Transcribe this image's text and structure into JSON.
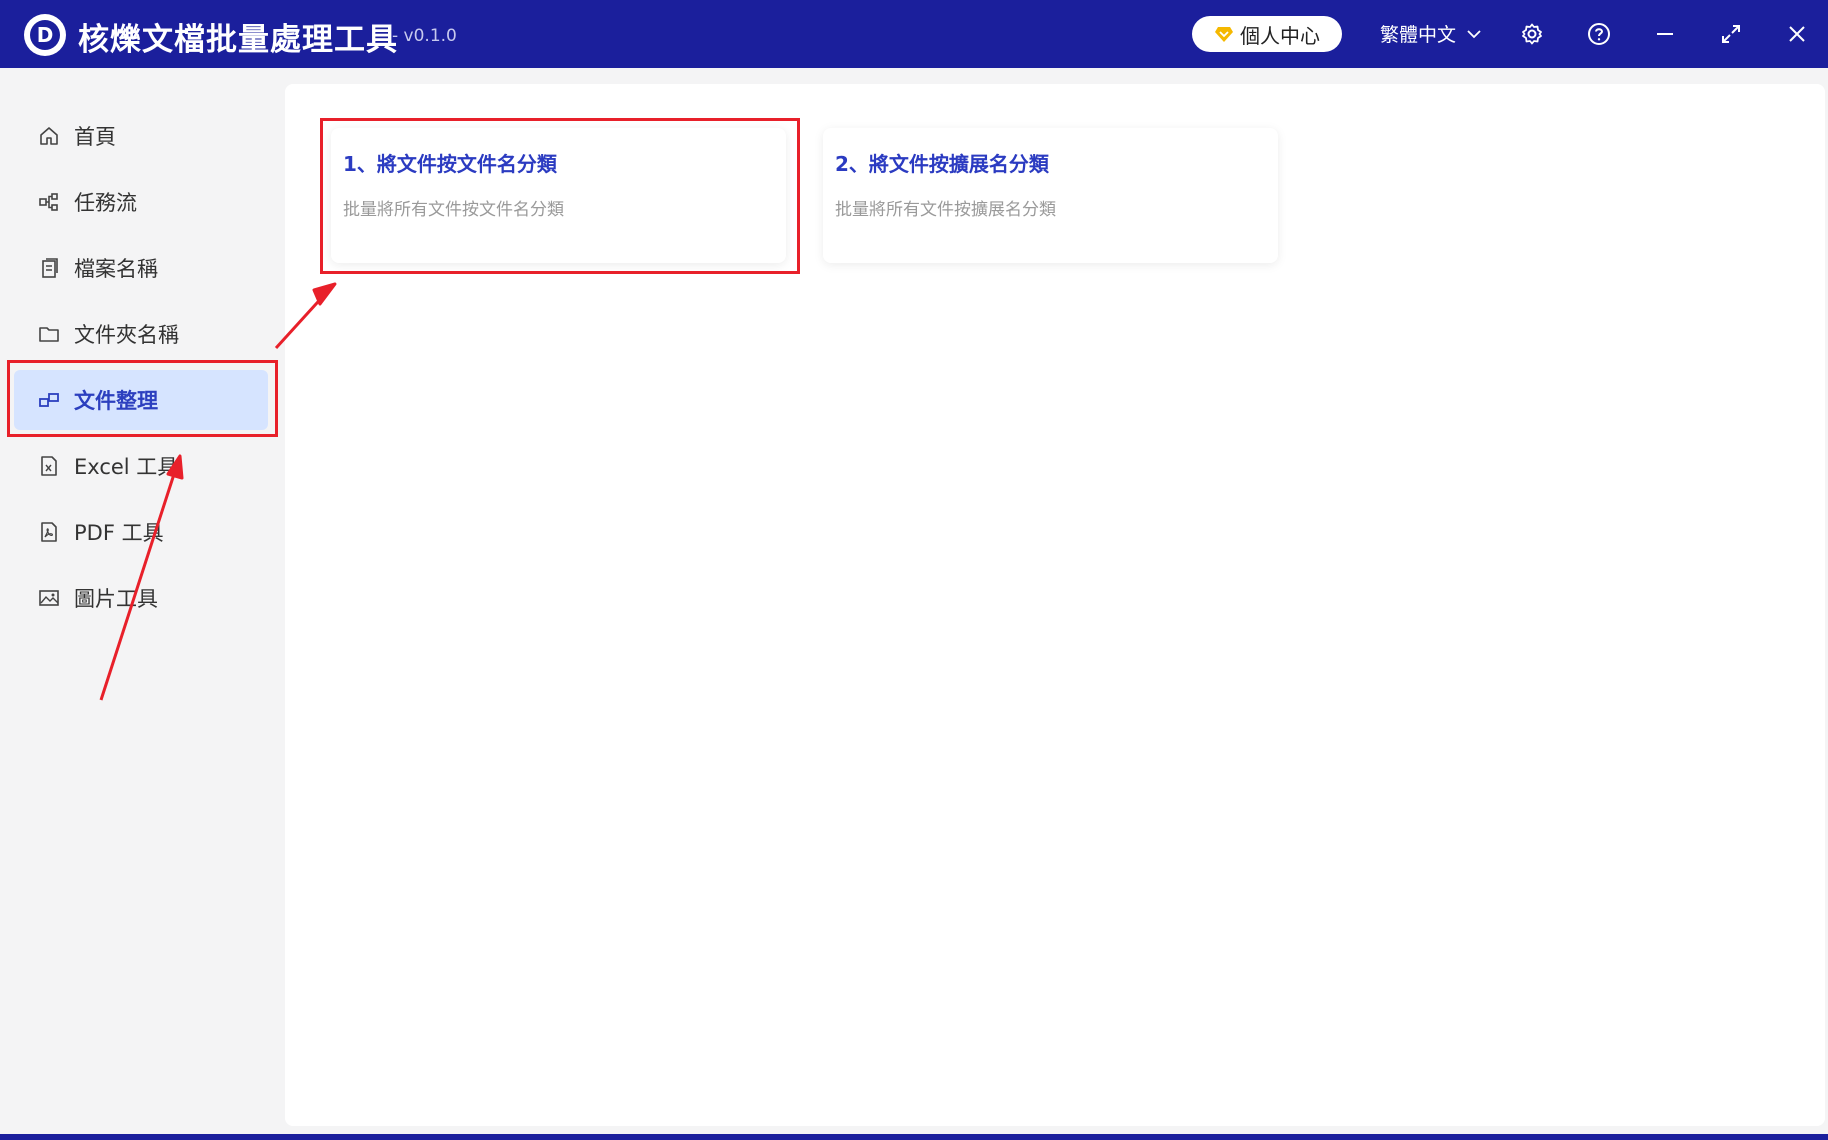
{
  "app": {
    "title": "核爍文檔批量處理工具",
    "version": "- v0.1.0",
    "logo_letter": "D"
  },
  "titlebar": {
    "user_center": "個人中心",
    "language": "繁體中文",
    "icons": [
      "diamond-icon",
      "chevron-down-icon",
      "gear-icon",
      "help-icon",
      "minimize-icon",
      "maximize-icon",
      "close-icon"
    ]
  },
  "sidebar": {
    "items": [
      {
        "label": "首頁",
        "icon": "home-icon"
      },
      {
        "label": "任務流",
        "icon": "workflow-icon"
      },
      {
        "label": "檔案名稱",
        "icon": "file-copy-icon"
      },
      {
        "label": "文件夾名稱",
        "icon": "folder-icon"
      },
      {
        "label": "文件整理",
        "icon": "organize-icon",
        "active": true
      },
      {
        "label": "Excel 工具",
        "icon": "excel-file-icon"
      },
      {
        "label": "PDF 工具",
        "icon": "pdf-file-icon"
      },
      {
        "label": "圖片工具",
        "icon": "image-icon"
      }
    ]
  },
  "main": {
    "cards": [
      {
        "title": "1、將文件按文件名分類",
        "desc": "批量將所有文件按文件名分類"
      },
      {
        "title": "2、將文件按擴展名分類",
        "desc": "批量將所有文件按擴展名分類"
      }
    ]
  },
  "colors": {
    "titlebar": "#1b1f9c",
    "accent": "#2b3bc1",
    "active_bg": "#d6e4ff",
    "annotation_red": "#e8202a"
  }
}
